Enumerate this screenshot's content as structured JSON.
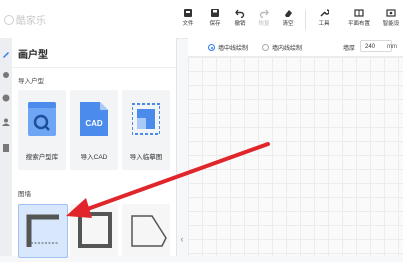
{
  "app": {
    "logo_text": "酷家乐"
  },
  "toolbar": {
    "file": "文件",
    "save": "保存",
    "undo": "撤销",
    "redo": "恢复",
    "clear": "清空",
    "tools": "工具",
    "layout": "平面布置",
    "smart": "智能设"
  },
  "panel": {
    "title": "画户型",
    "import_section": "导入户型",
    "import_cards": [
      {
        "label": "搜索户型库",
        "icon": "search-icon"
      },
      {
        "label": "导入CAD",
        "icon": "cad-file-icon"
      },
      {
        "label": "导入临摹图",
        "icon": "trace-image-icon"
      }
    ],
    "wall_section": "图墙"
  },
  "options": {
    "center_line": "墙中线绘制",
    "inner_line": "墙内线绘制",
    "thickness_label": "墙厚",
    "thickness_value": "240",
    "thickness_unit": "mm"
  },
  "colors": {
    "accent": "#2b7cf0",
    "arrow": "#e0262b"
  }
}
